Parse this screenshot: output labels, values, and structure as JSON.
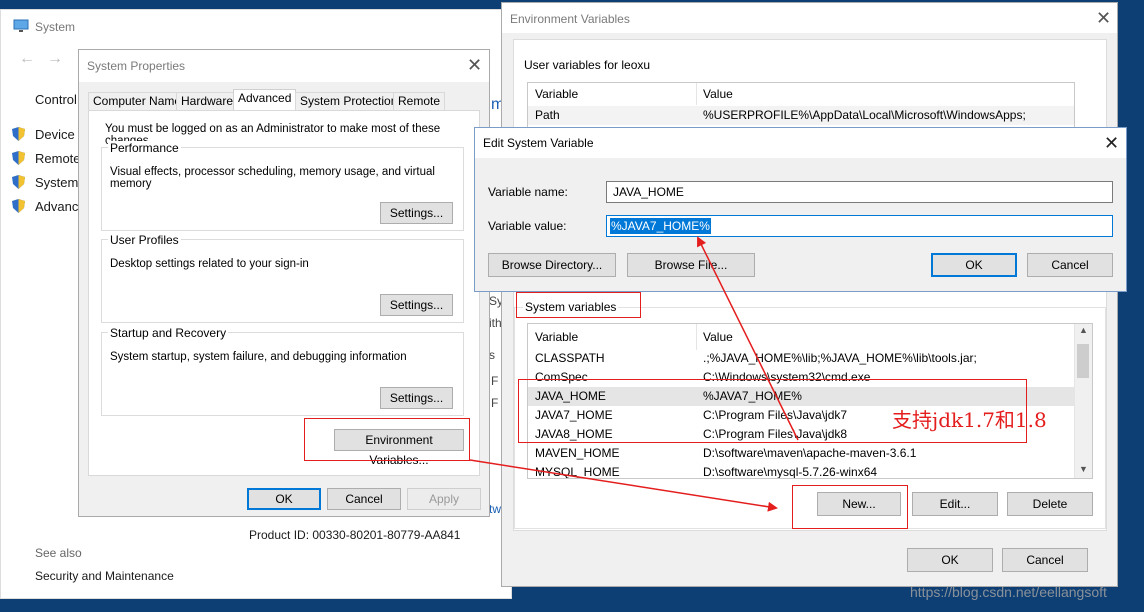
{
  "colors": {
    "desktop": "#0d3e74",
    "accent": "#0078d7",
    "annotation": "#e41d1d"
  },
  "system": {
    "title": "System",
    "nav_left": "Control I",
    "nav_items": [
      "Device M",
      "Remote",
      "System p",
      "Advance"
    ],
    "see_also_label": "See also",
    "see_also_link": "Security and Maintenance",
    "product_id": "Product ID:  00330-80201-80779-AA841",
    "bg_fragments": [
      "Sy",
      "ith",
      "s",
      "F",
      "F",
      "tw",
      "m"
    ]
  },
  "props": {
    "title": "System Properties",
    "tabs": [
      "Computer Name",
      "Hardware",
      "Advanced",
      "System Protection",
      "Remote"
    ],
    "admin_note": "You must be logged on as an Administrator to make most of these changes.",
    "perf": {
      "title": "Performance",
      "desc": "Visual effects, processor scheduling, memory usage, and virtual memory",
      "btn": "Settings..."
    },
    "profiles": {
      "title": "User Profiles",
      "desc": "Desktop settings related to your sign-in",
      "btn": "Settings..."
    },
    "startup": {
      "title": "Startup and Recovery",
      "desc": "System startup, system failure, and debugging information",
      "btn": "Settings..."
    },
    "env_btn": "Environment Variables...",
    "ok": "OK",
    "cancel": "Cancel",
    "apply": "Apply"
  },
  "env": {
    "title": "Environment Variables",
    "user_group": "User variables for leoxu",
    "col_var": "Variable",
    "col_val": "Value",
    "user_rows": [
      {
        "var": "Path",
        "val": "%USERPROFILE%\\AppData\\Local\\Microsoft\\WindowsApps;"
      }
    ],
    "sys_group": "System variables",
    "sys_rows": [
      {
        "var": "CLASSPATH",
        "val": ".;%JAVA_HOME%\\lib;%JAVA_HOME%\\lib\\tools.jar;"
      },
      {
        "var": "ComSpec",
        "val": "C:\\Windows\\system32\\cmd.exe"
      },
      {
        "var": "JAVA_HOME",
        "val": "%JAVA7_HOME%"
      },
      {
        "var": "JAVA7_HOME",
        "val": "C:\\Program Files\\Java\\jdk7"
      },
      {
        "var": "JAVA8_HOME",
        "val": "C:\\Program Files\\Java\\jdk8"
      },
      {
        "var": "MAVEN_HOME",
        "val": "D:\\software\\maven\\apache-maven-3.6.1"
      },
      {
        "var": "MYSQL_HOME",
        "val": "D:\\software\\mysql-5.7.26-winx64"
      }
    ],
    "new": "New...",
    "edit": "Edit...",
    "delete": "Delete",
    "ok": "OK",
    "cancel": "Cancel"
  },
  "edit": {
    "title": "Edit System Variable",
    "name_label": "Variable name:",
    "name_value": "JAVA_HOME",
    "value_label": "Variable value:",
    "value_value": "%JAVA7_HOME%",
    "browse_dir": "Browse Directory...",
    "browse_file": "Browse File...",
    "ok": "OK",
    "cancel": "Cancel"
  },
  "annotation": {
    "text": "支持jdk1.7和1.8"
  },
  "watermark": "https://blog.csdn.net/eellangsoft"
}
